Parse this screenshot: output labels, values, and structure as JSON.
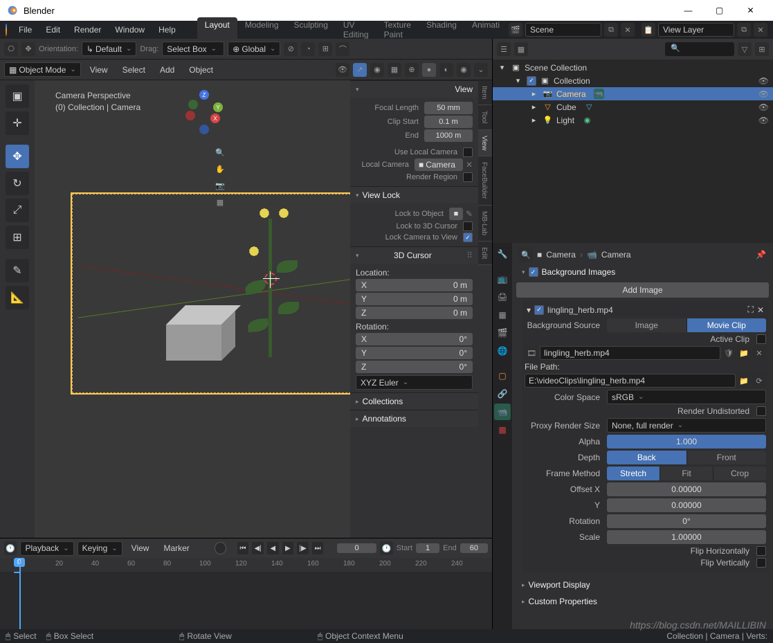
{
  "window": {
    "title": "Blender"
  },
  "topmenu": {
    "items": [
      "File",
      "Edit",
      "Render",
      "Window",
      "Help"
    ]
  },
  "tabs": [
    "Layout",
    "Modeling",
    "Sculpting",
    "UV Editing",
    "Texture Paint",
    "Shading",
    "Animati"
  ],
  "scene": {
    "name": "Scene",
    "layer": "View Layer"
  },
  "header3d": {
    "orientation_lbl": "Orientation:",
    "orientation": "Default",
    "drag_lbl": "Drag:",
    "drag": "Select Box",
    "global": "Global",
    "mode": "Object Mode",
    "menus": [
      "View",
      "Select",
      "Add",
      "Object"
    ]
  },
  "viewport": {
    "cam_title": "Camera Perspective",
    "cam_sub": "(0) Collection | Camera"
  },
  "npanel": {
    "view": {
      "title": "View",
      "focal_lbl": "Focal Length",
      "focal": "50 mm",
      "clipstart_lbl": "Clip Start",
      "clipstart": "0.1 m",
      "end_lbl": "End",
      "end": "1000 m",
      "use_local": "Use Local Camera",
      "local_cam_lbl": "Local Camera",
      "local_cam": "Camera",
      "render_region": "Render Region"
    },
    "viewlock": {
      "title": "View Lock",
      "lock_obj": "Lock to Object",
      "lock_3d": "Lock to 3D Cursor",
      "lock_cam": "Lock Camera to View"
    },
    "cursor": {
      "title": "3D Cursor",
      "loc_lbl": "Location:",
      "rot_lbl": "Rotation:",
      "x": "X",
      "y": "Y",
      "z": "Z",
      "zero_m": "0 m",
      "zero_d": "0°",
      "euler": "XYZ Euler"
    },
    "collections": "Collections",
    "annotations": "Annotations",
    "tabs": [
      "Item",
      "Tool",
      "View",
      "FaceBuilder",
      "MB-Lab",
      "Edit"
    ]
  },
  "timeline": {
    "playback": "Playback",
    "keying": "Keying",
    "view": "View",
    "marker": "Marker",
    "cur": "0",
    "start_lbl": "Start",
    "start": "1",
    "end_lbl": "End",
    "end": "60",
    "ticks": [
      "0",
      "20",
      "40",
      "60",
      "80",
      "100",
      "120",
      "140",
      "160",
      "180",
      "200",
      "220",
      "240"
    ]
  },
  "statusbar": {
    "select": "Select",
    "box": "Box Select",
    "rotate": "Rotate View",
    "ctx": "Object Context Menu",
    "info": "Collection | Camera | Verts:"
  },
  "outliner": {
    "scene_col": "Scene Collection",
    "collection": "Collection",
    "items": [
      {
        "name": "Camera",
        "icon": "📷",
        "sel": true
      },
      {
        "name": "Cube",
        "icon": "▽",
        "sel": false
      },
      {
        "name": "Light",
        "icon": "💡",
        "sel": false
      }
    ]
  },
  "props": {
    "crumb1": "Camera",
    "crumb2": "Camera",
    "bg_images": "Background Images",
    "add_image": "Add Image",
    "clip_name": "lingling_herb.mp4",
    "bg_src_lbl": "Background Source",
    "bg_src_img": "Image",
    "bg_src_clip": "Movie Clip",
    "active_clip": "Active Clip",
    "file_field": "lingling_herb.mp4",
    "filepath_lbl": "File Path:",
    "filepath": "E:\\videoClips\\lingling_herb.mp4",
    "colorspace_lbl": "Color Space",
    "colorspace": "sRGB",
    "render_undist": "Render Undistorted",
    "proxy_lbl": "Proxy Render Size",
    "proxy": "None, full render",
    "alpha_lbl": "Alpha",
    "alpha": "1.000",
    "depth_lbl": "Depth",
    "depth_back": "Back",
    "depth_front": "Front",
    "frame_lbl": "Frame Method",
    "frame_stretch": "Stretch",
    "frame_fit": "Fit",
    "frame_crop": "Crop",
    "offsetx_lbl": "Offset X",
    "offsety_lbl": "Y",
    "offset": "0.00000",
    "rotation_lbl": "Rotation",
    "rotation": "0°",
    "scale_lbl": "Scale",
    "scale": "1.00000",
    "flip_h": "Flip Horizontally",
    "flip_v": "Flip Vertically",
    "viewport_display": "Viewport Display",
    "custom_props": "Custom Properties"
  },
  "watermark": "https://blog.csdn.net/MAILLIBIN"
}
